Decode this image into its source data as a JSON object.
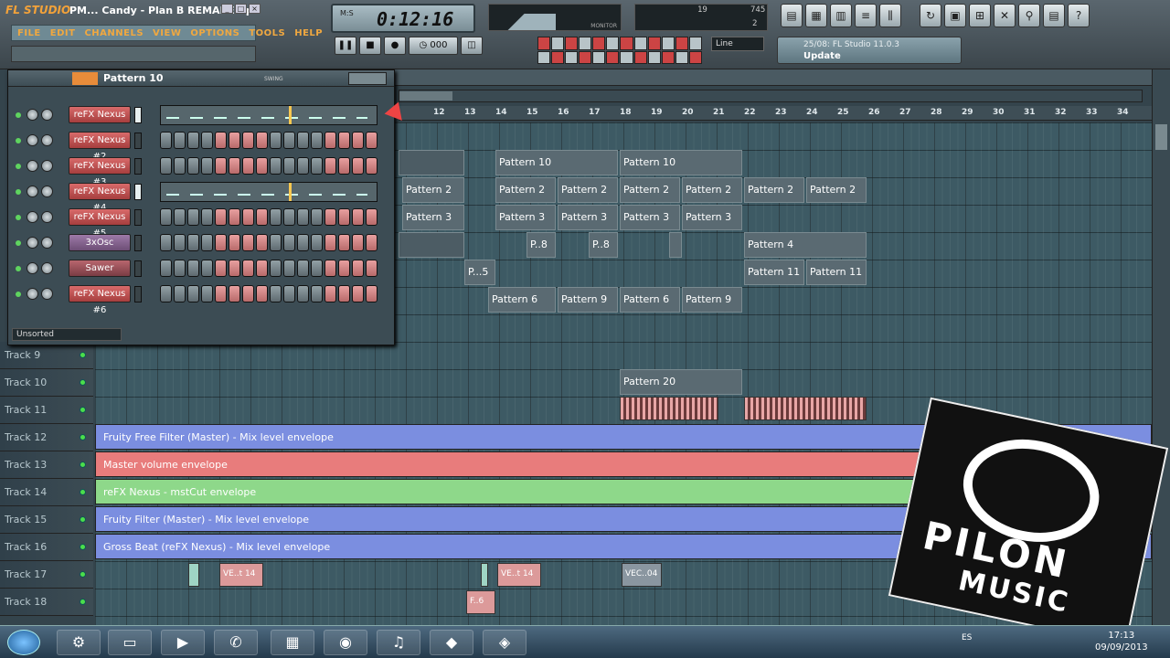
{
  "window": {
    "logo": "FL STUDIO",
    "title": "PM... Candy - Plan B REMAKE.flp"
  },
  "menu": [
    "FILE",
    "EDIT",
    "CHANNELS",
    "VIEW",
    "OPTIONS",
    "TOOLS",
    "HELP"
  ],
  "transport": {
    "time": "0:12:16",
    "time_label": "M:S",
    "cpu_a": "19",
    "cpu_b": "745",
    "cpu_c": "2",
    "monitor_label": "MONITOR",
    "snap": "Line"
  },
  "hint": {
    "line1": "25/08: FL Studio 11.0.3",
    "line2": "Update"
  },
  "rack": {
    "pattern": "Pattern 10",
    "swing": "SWING",
    "filter": "Unsorted",
    "channels": [
      {
        "name": "reFX Nexus",
        "style": "red",
        "graph": true,
        "selected": true
      },
      {
        "name": "reFX Nexus #2",
        "style": "red",
        "graph": false
      },
      {
        "name": "reFX Nexus #3",
        "style": "red",
        "graph": false
      },
      {
        "name": "reFX Nexus #4",
        "style": "red",
        "graph": true,
        "selected": true
      },
      {
        "name": "reFX Nexus #5",
        "style": "red",
        "graph": false
      },
      {
        "name": "3xOsc",
        "style": "pur",
        "graph": false
      },
      {
        "name": "Sawer",
        "style": "mrn",
        "graph": false
      },
      {
        "name": "reFX Nexus #6",
        "style": "red",
        "graph": false
      }
    ]
  },
  "ruler": [
    "12",
    "13",
    "14",
    "15",
    "16",
    "17",
    "18",
    "19",
    "20",
    "21",
    "22",
    "23",
    "24",
    "25",
    "26",
    "27",
    "28",
    "29",
    "30",
    "31",
    "32",
    "33",
    "34"
  ],
  "tracks": [
    "Track 9",
    "Track 10",
    "Track 11",
    "Track 12",
    "Track 13",
    "Track 14",
    "Track 15",
    "Track 16",
    "Track 17",
    "Track 18"
  ],
  "clips": {
    "r1": [
      "Pattern 10",
      "Pattern 10"
    ],
    "r2": [
      "Pattern 2",
      "Pattern 2",
      "Pattern 2",
      "Pattern 2",
      "Pattern 2",
      "Pattern 2",
      "Pattern 2"
    ],
    "r3": [
      "Pattern 3",
      "Pattern 3",
      "Pattern 3",
      "Pattern 3",
      "Pattern 3"
    ],
    "r4": [
      "P..8",
      "P..8",
      "Pattern 4"
    ],
    "r5": [
      "P...5",
      "Pattern 11",
      "Pattern 11"
    ],
    "r6": [
      "Pattern 6",
      "Pattern 9",
      "Pattern 6",
      "Pattern 9"
    ],
    "t10": "Pattern 20",
    "t17": [
      "VE..t 14",
      "VE..t 14",
      "VEC..04"
    ],
    "t18": "F..6"
  },
  "envelopes": [
    "Fruity Free Filter (Master) - Mix level envelope",
    "Master volume envelope",
    "reFX Nexus - mstCut envelope",
    "Fruity Filter (Master) - Mix level envelope",
    "Gross Beat (reFX Nexus) - Mix level envelope"
  ],
  "overlay": {
    "line1": "PILON",
    "line2": "MUSIC"
  },
  "taskbar": {
    "lang": "ES",
    "time": "17:13",
    "date": "09/09/2013"
  },
  "colors": {
    "accent": "#f0a840",
    "env_blue": "#7b8ee0",
    "env_red": "#e87c7c",
    "env_green": "#8ed88a"
  }
}
